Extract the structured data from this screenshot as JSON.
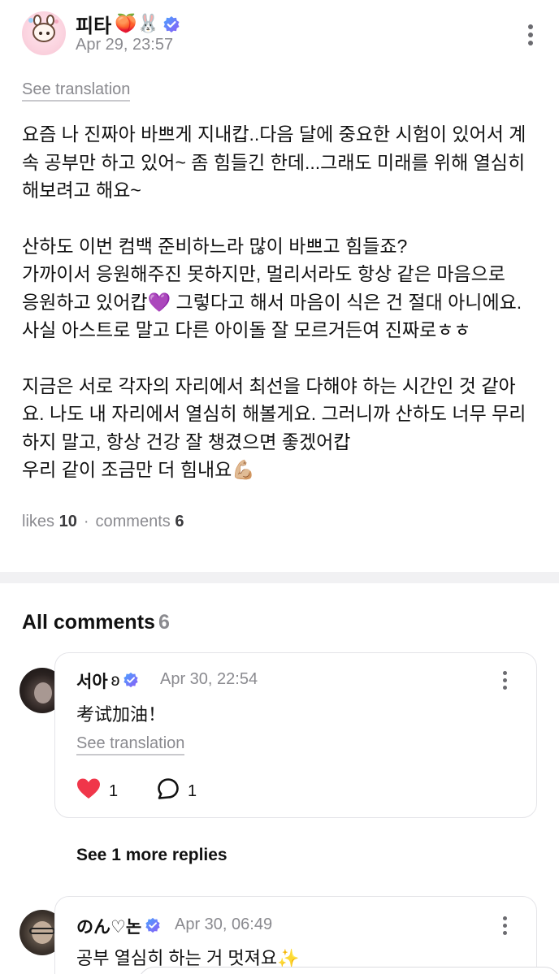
{
  "post": {
    "author_name": "피타",
    "author_emojis": "🍑🐰",
    "timestamp": "Apr 29, 23:57",
    "see_translation": "See translation",
    "paragraphs": [
      [
        "요즘 나 진짜아 바쁘게 지내캅..다음 달에 중요한 시험이 있어서 계",
        "속 공부만 하고 있어~ 좀 힘들긴 한데...그래도 미래를 위해 열심히",
        "해보려고 해요~"
      ],
      [
        "산하도 이번 컴백 준비하느라 많이 바쁘고 힘들죠?",
        "가까이서 응원해주진 못하지만, 멀리서라도 항상 같은 마음으로",
        "응원하고 있어캅💜 그렇다고 해서 마음이 식은 건 절대 아니에요.",
        "사실 아스트로 말고 다른 아이돌 잘 모르거든여 진짜로ㅎㅎ"
      ],
      [
        "지금은 서로 각자의 자리에서 최선을 다해야 하는 시간인 것 같아",
        "요. 나도 내 자리에서 열심히 해볼게요. 그러니까 산하도 너무 무리",
        "하지 말고, 항상 건강 잘 챙겼으면 좋겠어캅",
        "우리 같이 조금만 더 힘내요💪🏼"
      ]
    ],
    "likes_label": "likes",
    "likes_count": "10",
    "separator": "·",
    "comments_label": "comments",
    "comments_count": "6"
  },
  "comments_section": {
    "title": "All comments",
    "count": "6",
    "see_more_replies": "See 1 more replies",
    "items": [
      {
        "name": "서아",
        "name_suffix": "ʚ",
        "timestamp": "Apr 30, 22:54",
        "text": "考试加油！",
        "see_translation": "See translation",
        "likes": "1",
        "replies": "1"
      },
      {
        "name": "のん♡논",
        "timestamp": "Apr 30, 06:49",
        "text": "공부 열심히 하는 거 멋져요✨"
      }
    ]
  },
  "colors": {
    "accent_verified": "#5b6cff",
    "heart": "#f0364a",
    "muted_text": "#8a8a8f"
  },
  "icons": [
    "verified-badge-icon",
    "more-vertical-icon",
    "heart-icon",
    "comment-bubble-icon"
  ]
}
